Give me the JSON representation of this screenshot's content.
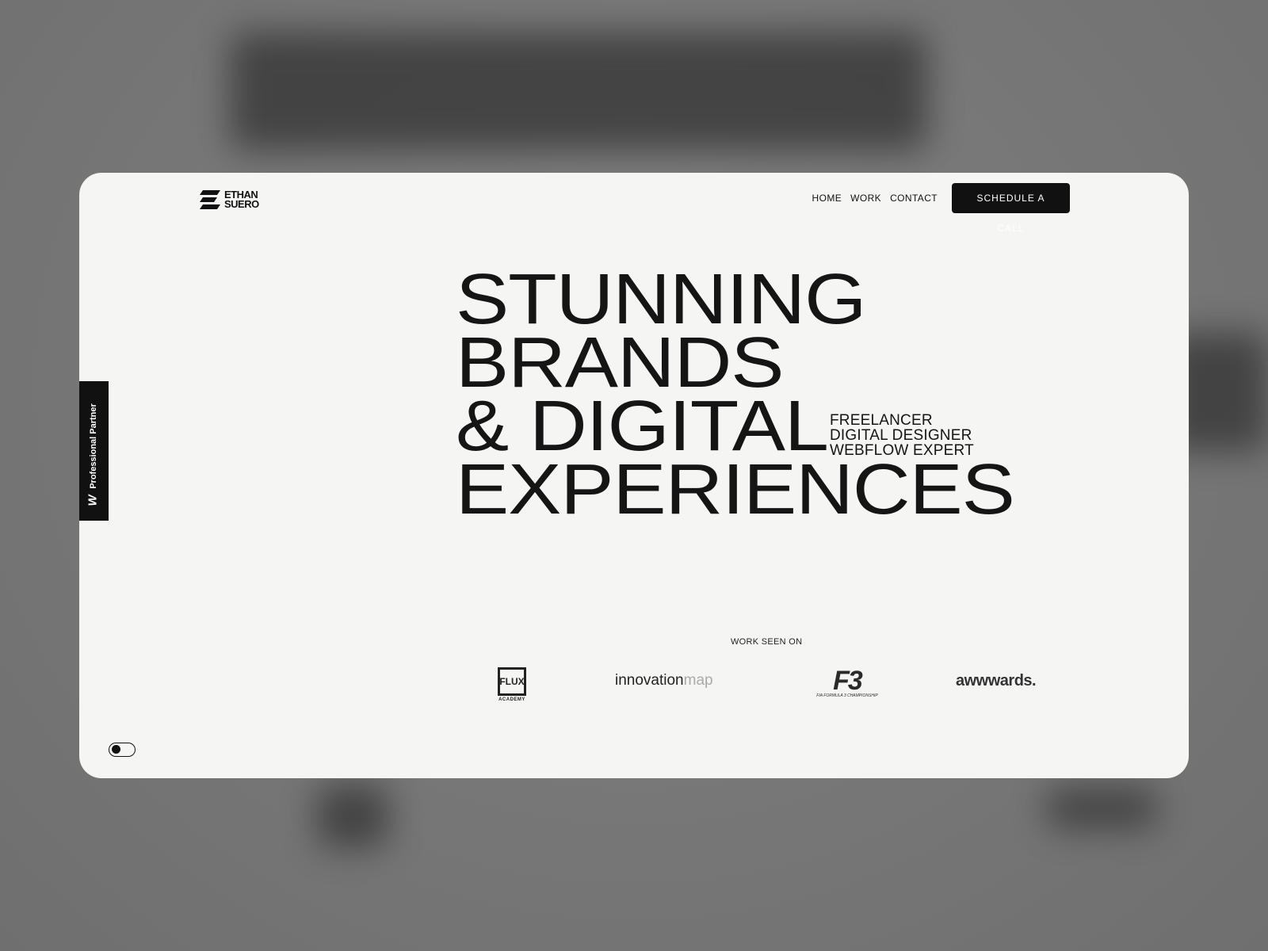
{
  "brand": {
    "line1": "ETHAN",
    "line2": "SUERO"
  },
  "nav": {
    "items": [
      {
        "label": "HOME"
      },
      {
        "label": "WORK"
      },
      {
        "label": "CONTACT"
      }
    ],
    "cta_label": "SCHEDULE A CALL"
  },
  "hero": {
    "lines": [
      "STUNNING",
      "BRANDS",
      "& DIGITAL",
      "EXPERIENCES"
    ],
    "roles": [
      "FREELANCER",
      "DIGITAL DESIGNER",
      "WEBFLOW EXPERT"
    ]
  },
  "badge": {
    "label": "Professional Partner",
    "mark": "W"
  },
  "work_seen": {
    "label": "WORK SEEN ON",
    "logos": {
      "flux_main": "FLUX",
      "flux_sub": "ACADEMY",
      "innovation_dark": "innovation",
      "innovation_light": "map",
      "f3_mark": "F3",
      "f3_sub": "FIA FORMULA 3 CHAMPIONSHIP",
      "awwwards": "awwwards."
    }
  },
  "theme_toggle": {
    "state": "dark-knob-left"
  },
  "colors": {
    "background": "#7a7a7a",
    "card": "#f5f5f4",
    "text": "#151515",
    "cta_bg": "#111111",
    "cta_text": "#ffffff"
  }
}
